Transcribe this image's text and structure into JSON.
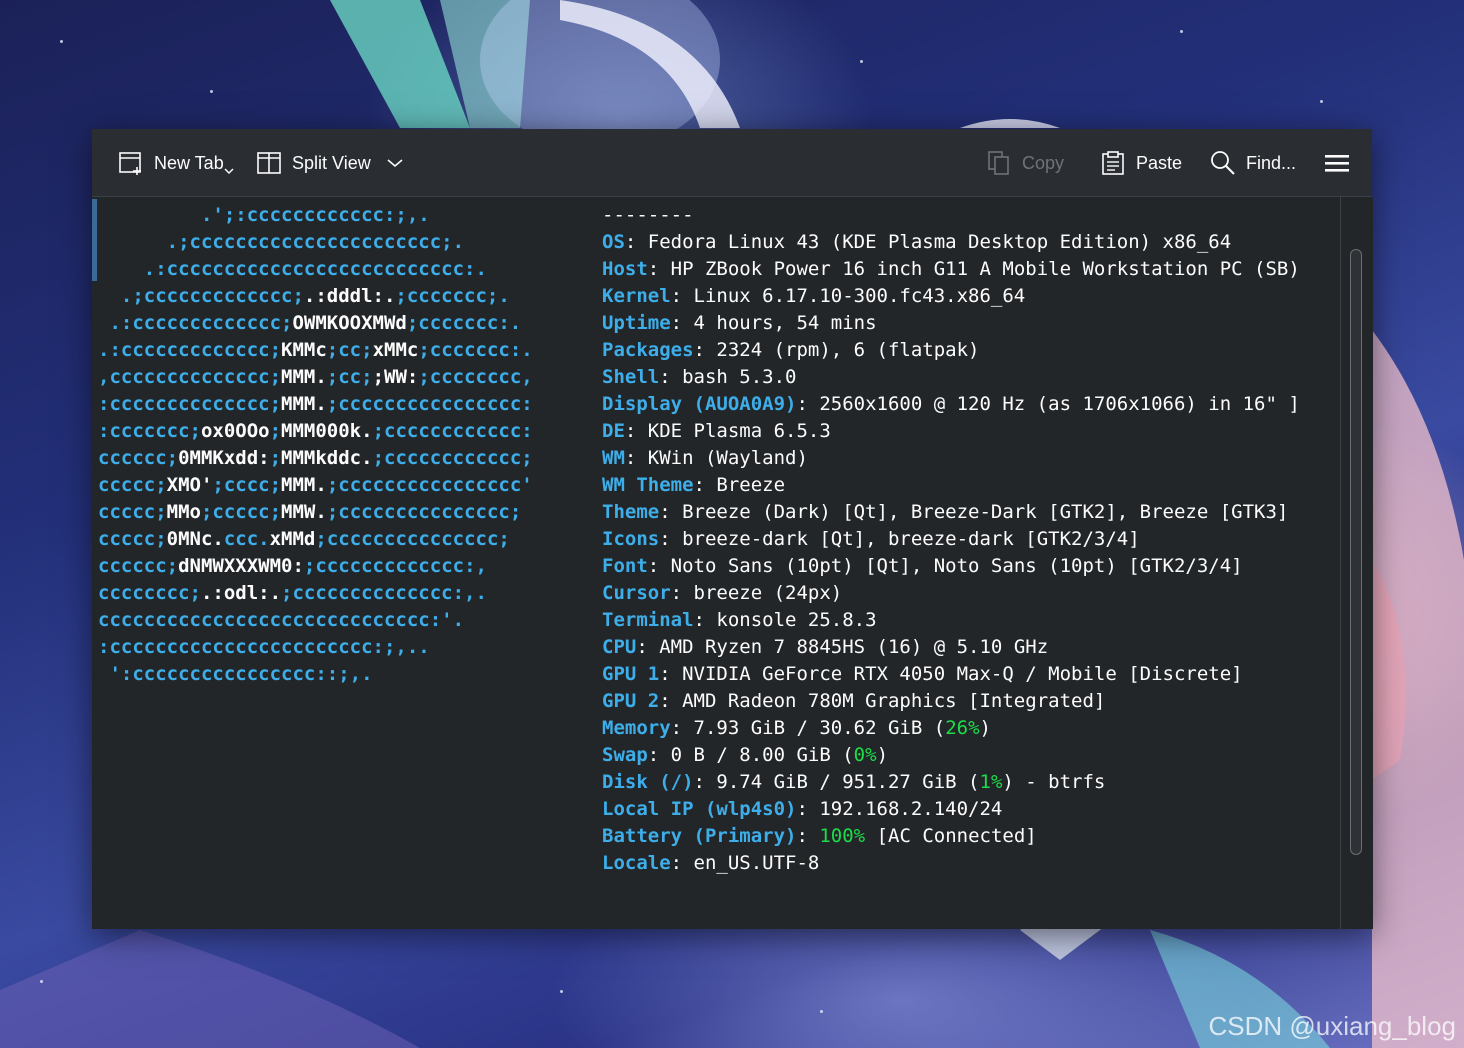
{
  "toolbar": {
    "new_tab": "New Tab",
    "split_view": "Split View",
    "copy": "Copy",
    "paste": "Paste",
    "find": "Find..."
  },
  "logo_lines": [
    [
      {
        "t": "         .';:cccccccccccc:;,.",
        "c": "b"
      }
    ],
    [
      {
        "t": "      .;cccccccccccccccccccccc;.",
        "c": "b"
      }
    ],
    [
      {
        "t": "    .:cccccccccccccccccccccccccc:.",
        "c": "b"
      }
    ],
    [
      {
        "t": "  .;ccccccccccccc;",
        "c": "b"
      },
      {
        "t": ".:dddl:.",
        "c": "w"
      },
      {
        "t": ";ccccccc;.",
        "c": "b"
      }
    ],
    [
      {
        "t": " .:ccccccccccccc;",
        "c": "b"
      },
      {
        "t": "OWMKOOXMWd",
        "c": "w"
      },
      {
        "t": ";ccccccc:.",
        "c": "b"
      }
    ],
    [
      {
        "t": ".:ccccccccccccc;",
        "c": "b"
      },
      {
        "t": "KMMc",
        "c": "w"
      },
      {
        "t": ";cc;",
        "c": "b"
      },
      {
        "t": "xMMc",
        "c": "w"
      },
      {
        "t": ";ccccccc:.",
        "c": "b"
      }
    ],
    [
      {
        "t": ",cccccccccccccc;",
        "c": "b"
      },
      {
        "t": "MMM.",
        "c": "w"
      },
      {
        "t": ";cc;",
        "c": "b"
      },
      {
        "t": ";WW:",
        "c": "w"
      },
      {
        "t": ";cccccccc,",
        "c": "b"
      }
    ],
    [
      {
        "t": ":cccccccccccccc;",
        "c": "b"
      },
      {
        "t": "MMM.",
        "c": "w"
      },
      {
        "t": ";cccccccccccccccc:",
        "c": "b"
      }
    ],
    [
      {
        "t": ":ccccccc;",
        "c": "b"
      },
      {
        "t": "ox0OOo",
        "c": "w"
      },
      {
        "t": ";",
        "c": "b"
      },
      {
        "t": "MMM000k.",
        "c": "w"
      },
      {
        "t": ";cccccccccccc:",
        "c": "b"
      }
    ],
    [
      {
        "t": "cccccc;",
        "c": "b"
      },
      {
        "t": "0MMKxdd:",
        "c": "w"
      },
      {
        "t": ";",
        "c": "b"
      },
      {
        "t": "MMMkddc.",
        "c": "w"
      },
      {
        "t": ";cccccccccccc;",
        "c": "b"
      }
    ],
    [
      {
        "t": "ccccc;",
        "c": "b"
      },
      {
        "t": "XMO'",
        "c": "w"
      },
      {
        "t": ";cccc;",
        "c": "b"
      },
      {
        "t": "MMM.",
        "c": "w"
      },
      {
        "t": ";cccccccccccccccc'",
        "c": "b"
      }
    ],
    [
      {
        "t": "ccccc;",
        "c": "b"
      },
      {
        "t": "MMo",
        "c": "w"
      },
      {
        "t": ";ccccc;",
        "c": "b"
      },
      {
        "t": "MMW.",
        "c": "w"
      },
      {
        "t": ";ccccccccccccccc;",
        "c": "b"
      }
    ],
    [
      {
        "t": "ccccc;",
        "c": "b"
      },
      {
        "t": "0MNc.",
        "c": "w"
      },
      {
        "t": "ccc.",
        "c": "b"
      },
      {
        "t": "xMMd",
        "c": "w"
      },
      {
        "t": ";ccccccccccccccc;",
        "c": "b"
      }
    ],
    [
      {
        "t": "cccccc;",
        "c": "b"
      },
      {
        "t": "dNMWXXXWM0:",
        "c": "w"
      },
      {
        "t": ";ccccccccccccc:,",
        "c": "b"
      }
    ],
    [
      {
        "t": "cccccccc;",
        "c": "b"
      },
      {
        "t": ".:odl:.",
        "c": "w"
      },
      {
        "t": ";cccccccccccccc:,.",
        "c": "b"
      }
    ],
    [
      {
        "t": "ccccccccccccccccccccccccccccc:'.",
        "c": "b"
      }
    ],
    [
      {
        "t": ":ccccccccccccccccccccccc:;,..",
        "c": "b"
      }
    ],
    [
      {
        "t": " ':cccccccccccccccc::;,.",
        "c": "b"
      }
    ]
  ],
  "info_lines": [
    [
      {
        "t": "--------",
        "c": "n"
      }
    ],
    [
      {
        "t": "OS",
        "c": "k"
      },
      {
        "t": ": Fedora Linux 43 (KDE Plasma Desktop Edition) x86_64",
        "c": "n"
      }
    ],
    [
      {
        "t": "Host",
        "c": "k"
      },
      {
        "t": ": HP ZBook Power 16 inch G11 A Mobile Workstation PC (SB)",
        "c": "n"
      }
    ],
    [
      {
        "t": "Kernel",
        "c": "k"
      },
      {
        "t": ": Linux 6.17.10-300.fc43.x86_64",
        "c": "n"
      }
    ],
    [
      {
        "t": "Uptime",
        "c": "k"
      },
      {
        "t": ": 4 hours, 54 mins",
        "c": "n"
      }
    ],
    [
      {
        "t": "Packages",
        "c": "k"
      },
      {
        "t": ": 2324 (rpm), 6 (flatpak)",
        "c": "n"
      }
    ],
    [
      {
        "t": "Shell",
        "c": "k"
      },
      {
        "t": ": bash 5.3.0",
        "c": "n"
      }
    ],
    [
      {
        "t": "Display (AUOA0A9)",
        "c": "k"
      },
      {
        "t": ": 2560x1600 @ 120 Hz (as 1706x1066) in 16\" ]",
        "c": "n"
      }
    ],
    [
      {
        "t": "DE",
        "c": "k"
      },
      {
        "t": ": KDE Plasma 6.5.3",
        "c": "n"
      }
    ],
    [
      {
        "t": "WM",
        "c": "k"
      },
      {
        "t": ": KWin (Wayland)",
        "c": "n"
      }
    ],
    [
      {
        "t": "WM Theme",
        "c": "k"
      },
      {
        "t": ": Breeze",
        "c": "n"
      }
    ],
    [
      {
        "t": "Theme",
        "c": "k"
      },
      {
        "t": ": Breeze (Dark) [Qt], Breeze-Dark [GTK2], Breeze [GTK3]",
        "c": "n"
      }
    ],
    [
      {
        "t": "Icons",
        "c": "k"
      },
      {
        "t": ": breeze-dark [Qt], breeze-dark [GTK2/3/4]",
        "c": "n"
      }
    ],
    [
      {
        "t": "Font",
        "c": "k"
      },
      {
        "t": ": Noto Sans (10pt) [Qt], Noto Sans (10pt) [GTK2/3/4]",
        "c": "n"
      }
    ],
    [
      {
        "t": "Cursor",
        "c": "k"
      },
      {
        "t": ": breeze (24px)",
        "c": "n"
      }
    ],
    [
      {
        "t": "Terminal",
        "c": "k"
      },
      {
        "t": ": konsole 25.8.3",
        "c": "n"
      }
    ],
    [
      {
        "t": "CPU",
        "c": "k"
      },
      {
        "t": ": AMD Ryzen 7 8845HS (16) @ 5.10 GHz",
        "c": "n"
      }
    ],
    [
      {
        "t": "GPU 1",
        "c": "k"
      },
      {
        "t": ": NVIDIA GeForce RTX 4050 Max-Q / Mobile [Discrete]",
        "c": "n"
      }
    ],
    [
      {
        "t": "GPU 2",
        "c": "k"
      },
      {
        "t": ": AMD Radeon 780M Graphics [Integrated]",
        "c": "n"
      }
    ],
    [
      {
        "t": "Memory",
        "c": "k"
      },
      {
        "t": ": 7.93 GiB / 30.62 GiB (",
        "c": "n"
      },
      {
        "t": "26%",
        "c": "g"
      },
      {
        "t": ")",
        "c": "n"
      }
    ],
    [
      {
        "t": "Swap",
        "c": "k"
      },
      {
        "t": ": 0 B / 8.00 GiB (",
        "c": "n"
      },
      {
        "t": "0%",
        "c": "g"
      },
      {
        "t": ")",
        "c": "n"
      }
    ],
    [
      {
        "t": "Disk (/)",
        "c": "k"
      },
      {
        "t": ": 9.74 GiB / 951.27 GiB (",
        "c": "n"
      },
      {
        "t": "1%",
        "c": "g"
      },
      {
        "t": ") - btrfs",
        "c": "n"
      }
    ],
    [
      {
        "t": "Local IP (wlp4s0)",
        "c": "k"
      },
      {
        "t": ": 192.168.2.140/24",
        "c": "n"
      }
    ],
    [
      {
        "t": "Battery (Primary)",
        "c": "k"
      },
      {
        "t": ": ",
        "c": "n"
      },
      {
        "t": "100%",
        "c": "g"
      },
      {
        "t": " [AC Connected]",
        "c": "n"
      }
    ],
    [
      {
        "t": "Locale",
        "c": "k"
      },
      {
        "t": ": en_US.UTF-8",
        "c": "n"
      }
    ]
  ],
  "watermark": "CSDN @uxiang_blog",
  "colors": {
    "accent_blue": "#3daee9",
    "percent_green": "#1cdc4a",
    "terminal_bg": "#232629",
    "toolbar_bg": "#2a2e32",
    "text": "#fcfcfc"
  }
}
